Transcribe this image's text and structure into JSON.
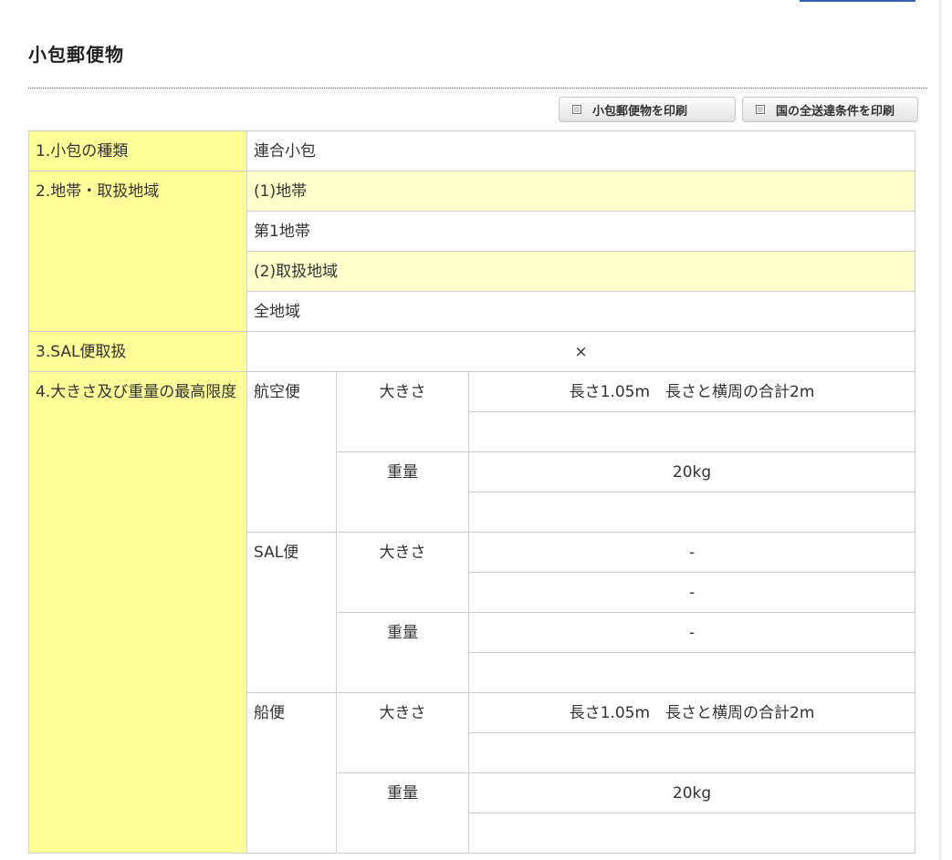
{
  "section_title": "小包郵便物",
  "buttons": {
    "print_parcel": "小包郵便物を印刷",
    "print_all_conditions": "国の全送達条件を印刷"
  },
  "rows": {
    "type": {
      "label": "1.小包の種類",
      "value": "連合小包"
    },
    "zone": {
      "label": "2.地帯・取扱地域",
      "zone_header": "(1)地帯",
      "zone_value": "第1地帯",
      "area_header": "(2)取扱地域",
      "area_value": "全地域"
    },
    "sal": {
      "label": "3.SAL便取扱",
      "value": "×"
    },
    "limits": {
      "label": "4.大きさ及び重量の最高限度",
      "air": {
        "label": "航空便",
        "size_label": "大きさ",
        "size_value": "長さ1.05m　長さと横周の合計2m",
        "size_value2": "",
        "weight_label": "重量",
        "weight_value": "20kg",
        "weight_value2": ""
      },
      "sal": {
        "label": "SAL便",
        "size_label": "大きさ",
        "size_value": "-",
        "size_value2": "-",
        "weight_label": "重量",
        "weight_value": "-",
        "weight_value2": ""
      },
      "ship": {
        "label": "船便",
        "size_label": "大きさ",
        "size_value": "長さ1.05m　長さと横周の合計2m",
        "size_value2": "",
        "weight_label": "重量",
        "weight_value": "20kg",
        "weight_value2": ""
      }
    }
  }
}
